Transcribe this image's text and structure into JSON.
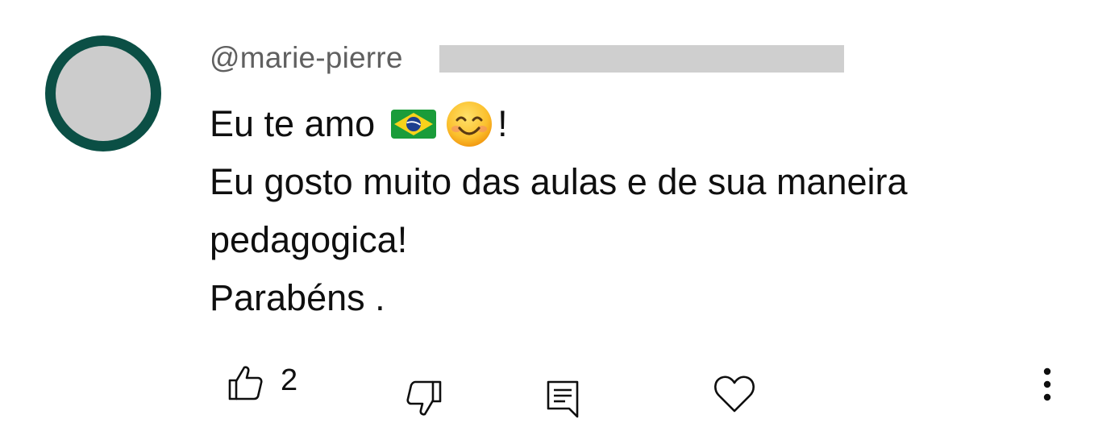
{
  "comment": {
    "handle": "@marie-pierre",
    "lines": [
      "Eu te amo",
      "Eu gosto muito das aulas e de sua maneira",
      "pedagogica!",
      "Parabéns ."
    ],
    "line1_suffix": "!",
    "emoji": [
      "brazil-flag-emoji",
      "smiling-face-emoji"
    ]
  },
  "actions": {
    "like_count": "2",
    "icons": [
      "thumbs-up-icon",
      "thumbs-down-icon",
      "reply-icon",
      "heart-icon",
      "more-vertical-icon"
    ]
  },
  "colors": {
    "avatar_ring": "#0b4f45",
    "avatar_fill": "#cccccc",
    "redaction": "#cfcfcf",
    "secondary_text": "#606060",
    "primary_text": "#0f0f0f"
  }
}
